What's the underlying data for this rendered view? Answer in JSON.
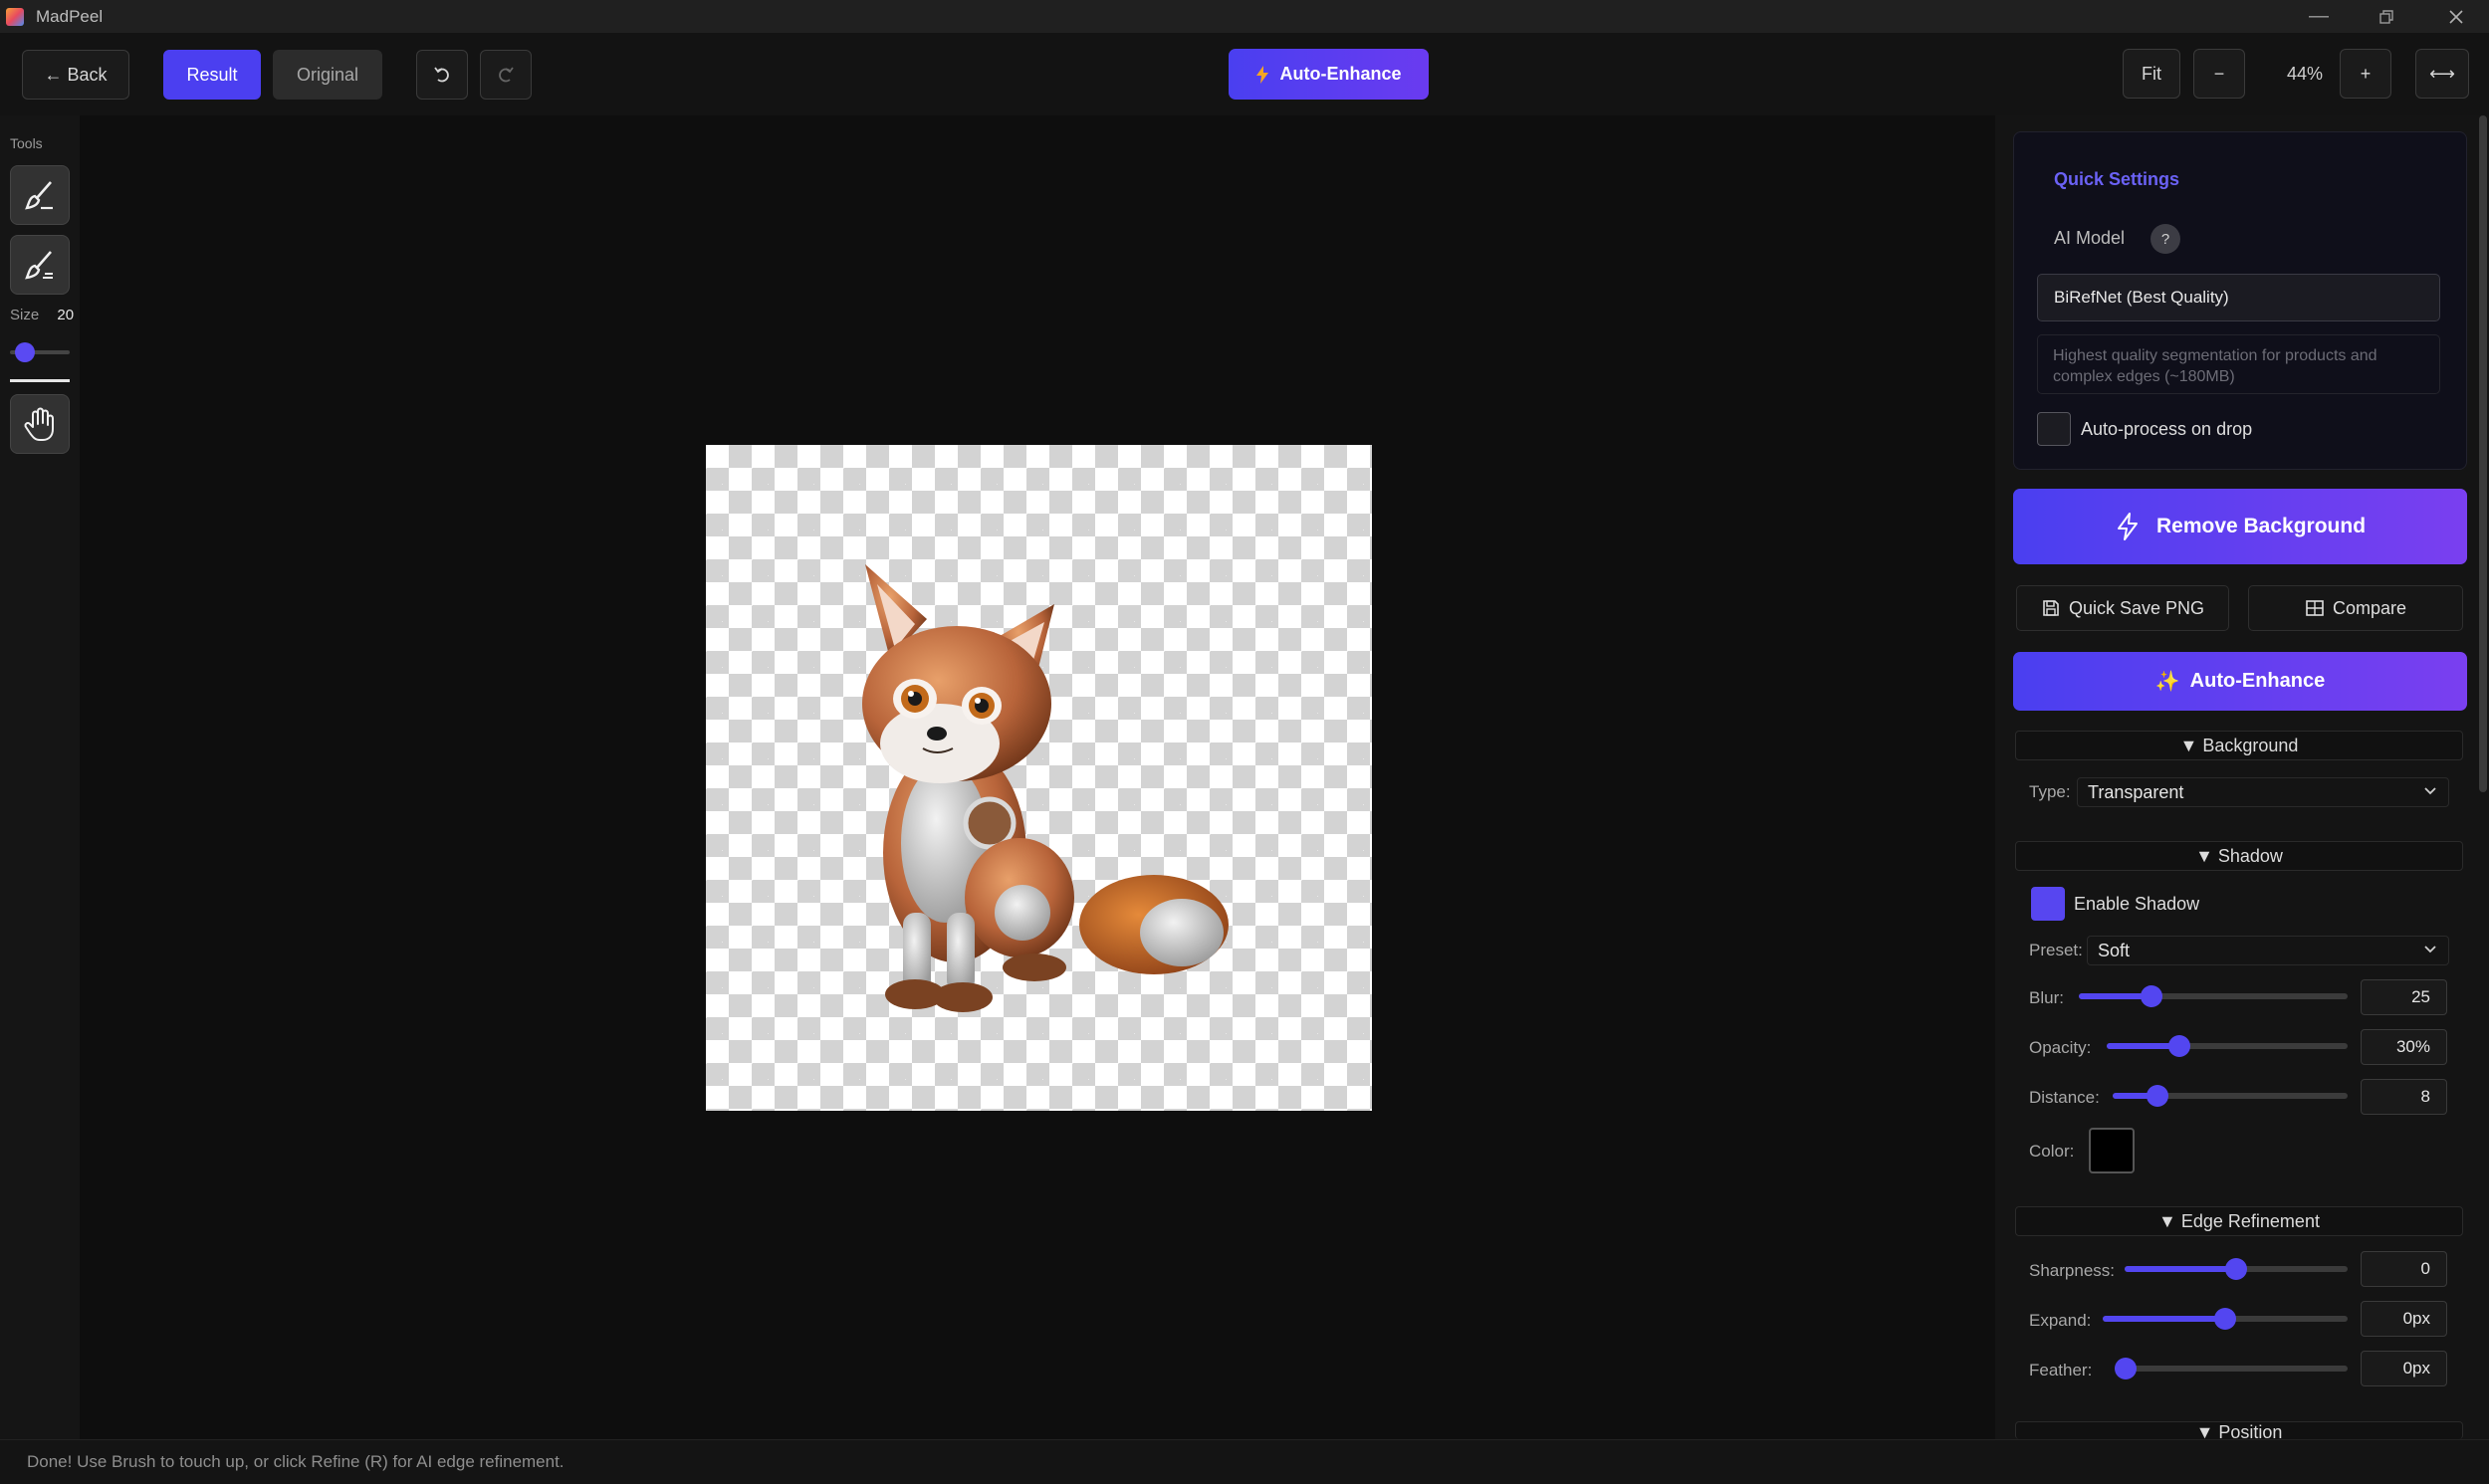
{
  "window": {
    "title": "MadPeel"
  },
  "toolbar": {
    "back_label": "← Back",
    "result_label": "Result",
    "original_label": "Original",
    "auto_enhance_label": "Auto-Enhance",
    "fit_label": "Fit",
    "zoom_out_label": "−",
    "zoom_level": "44%",
    "zoom_in_label": "+",
    "fit_width_label": "⟷"
  },
  "tools": {
    "label": "Tools",
    "size_label": "Size",
    "size_value": "20",
    "size_fraction": 0.12
  },
  "quick_settings": {
    "title": "Quick Settings",
    "ai_model_label": "AI Model",
    "help_label": "?",
    "model_value": "BiRefNet (Best Quality)",
    "model_description": "Highest quality segmentation for products and complex edges (~180MB)",
    "auto_process_label": "Auto-process on drop",
    "auto_process_checked": false
  },
  "actions": {
    "remove_background_label": "Remove Background",
    "quick_save_label": "Quick Save PNG",
    "compare_label": "Compare",
    "auto_enhance_label": "Auto-Enhance"
  },
  "background": {
    "header": "▼ Background",
    "type_label": "Type:",
    "type_value": "Transparent"
  },
  "shadow": {
    "header": "▼ Shadow",
    "enable_label": "Enable Shadow",
    "enabled": true,
    "preset_label": "Preset:",
    "preset_value": "Soft",
    "blur_label": "Blur:",
    "blur_value": "25",
    "blur_fraction": 0.27,
    "opacity_label": "Opacity:",
    "opacity_value": "30%",
    "opacity_fraction": 0.3,
    "distance_label": "Distance:",
    "distance_value": "8",
    "distance_fraction": 0.19,
    "color_label": "Color:",
    "color_value": "#000000"
  },
  "edge_refinement": {
    "header": "▼ Edge Refinement",
    "sharpness_label": "Sharpness:",
    "sharpness_value": "0",
    "sharpness_fraction": 0.5,
    "expand_label": "Expand:",
    "expand_value": "0px",
    "expand_fraction": 0.5,
    "feather_label": "Feather:",
    "feather_value": "0px",
    "feather_fraction": 0.0
  },
  "position": {
    "header": "▼ Position"
  },
  "status": {
    "text": "Done! Use Brush to touch up, or click Refine (R) for AI edge refinement."
  },
  "colors": {
    "accent": "#5346f0",
    "accent_light": "#6b62f6"
  }
}
